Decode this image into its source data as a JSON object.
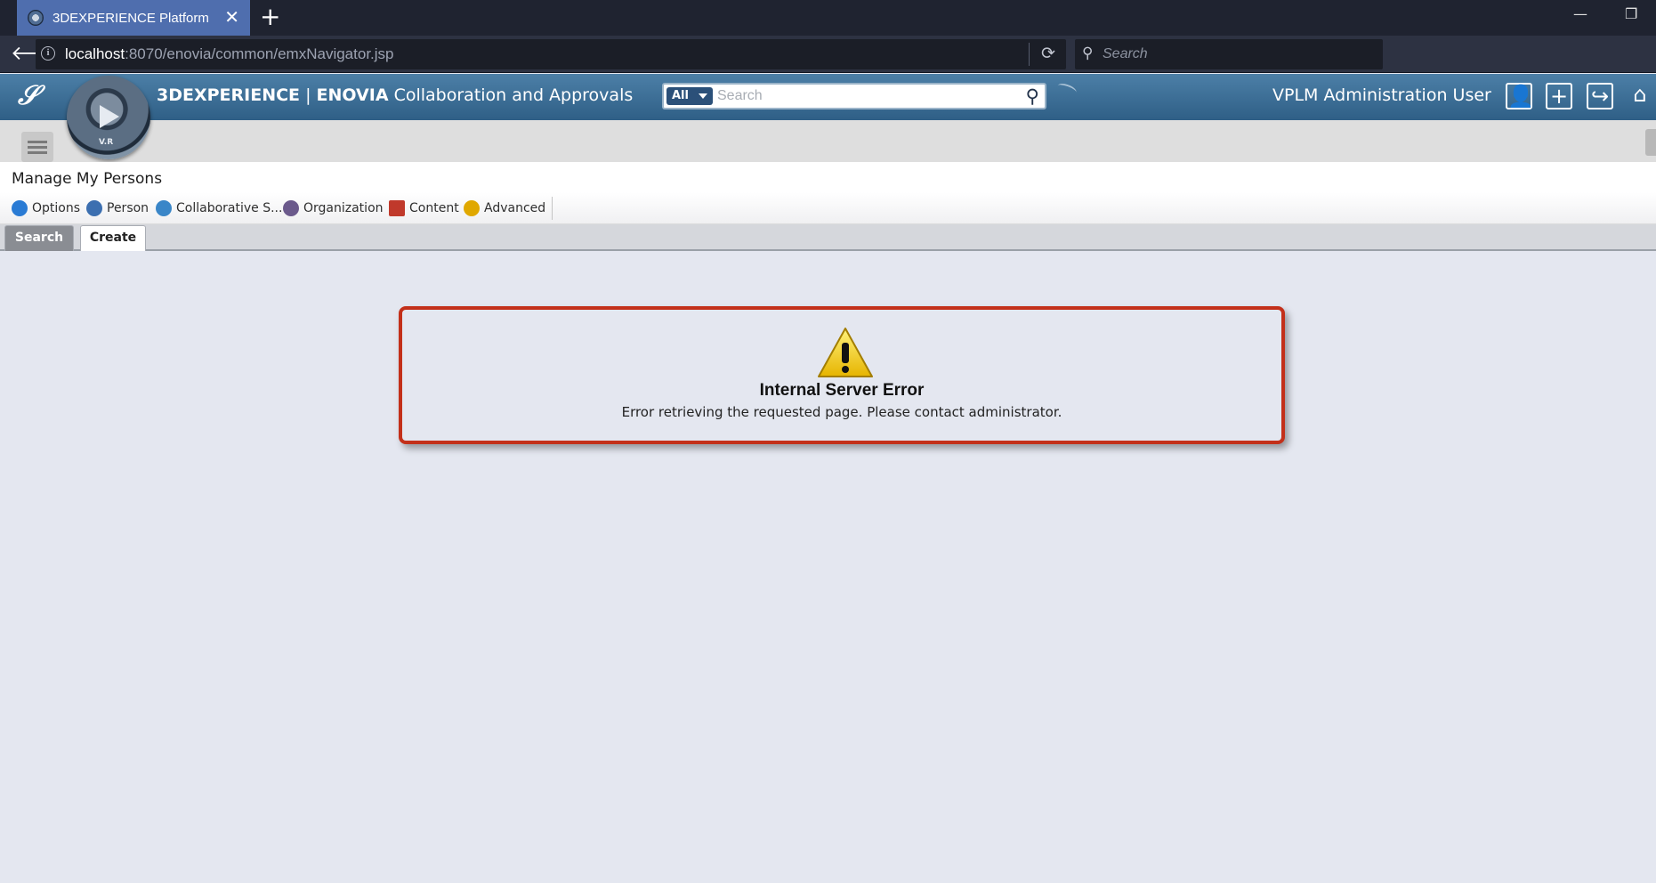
{
  "browser": {
    "tab_title": "3DEXPERIENCE Platform",
    "new_tab_label": "+",
    "url_host": "localhost",
    "url_rest": ":8070/enovia/common/emxNavigator.jsp",
    "search_placeholder": "Search"
  },
  "header": {
    "brand": "3DEXPERIENCE",
    "product": "ENOVIA",
    "app_name": "Collaboration and Approvals",
    "compass_label": "V.R",
    "search_scope": "All",
    "search_placeholder": "Search",
    "user_name": "VPLM Administration User"
  },
  "page": {
    "title": "Manage My Persons",
    "toolbar": [
      {
        "label": "Options",
        "icon": "options-icon",
        "color": "#2a7bd4"
      },
      {
        "label": "Person",
        "icon": "person-icon",
        "color": "#3c6fb0"
      },
      {
        "label": "Collaborative S...",
        "icon": "collaborative-space-icon",
        "color": "#3a86c8"
      },
      {
        "label": "Organization",
        "icon": "organization-icon",
        "color": "#6b5a8c"
      },
      {
        "label": "Content",
        "icon": "content-icon",
        "color": "#c0392b"
      },
      {
        "label": "Advanced",
        "icon": "advanced-icon",
        "color": "#e0a800"
      }
    ],
    "tabs": [
      {
        "label": "Search"
      },
      {
        "label": "Create"
      }
    ]
  },
  "error": {
    "title": "Internal Server Error",
    "message": "Error retrieving the requested page. Please contact administrator.",
    "border_color": "#c3301a"
  }
}
